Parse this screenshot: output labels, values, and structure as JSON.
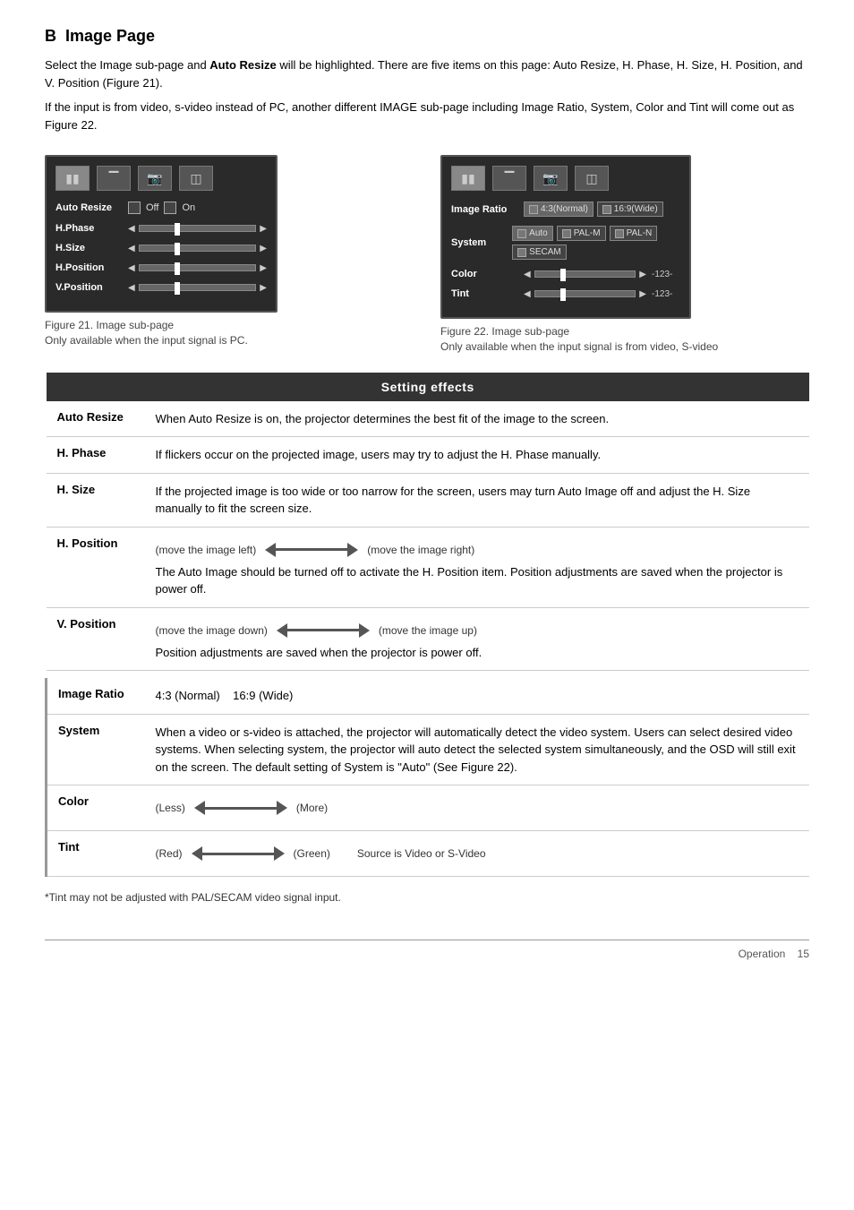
{
  "section": {
    "letter": "B",
    "title": "Image Page"
  },
  "intro": {
    "para1": "Select the Image sub-page and Auto Resize will be highlighted. There are five items on this page: Auto Resize, H. Phase, H. Size, H. Position, and V. Position (Figure 21).",
    "para2": "If the input is from video, s-video instead of PC, another different IMAGE sub-page including Image Ratio, System, Color and Tint will come out as Figure 22."
  },
  "figure21": {
    "caption_line1": "Figure 21. Image sub-page",
    "caption_line2": "Only available when the input signal is PC.",
    "rows": [
      {
        "label": "Auto Resize",
        "type": "checkbox",
        "opts": [
          "Off",
          "On"
        ]
      },
      {
        "label": "H.Phase",
        "type": "slider"
      },
      {
        "label": "H.Size",
        "type": "slider"
      },
      {
        "label": "H.Position",
        "type": "slider"
      },
      {
        "label": "V.Position",
        "type": "slider"
      }
    ]
  },
  "figure22": {
    "caption_line1": "Figure 22. Image sub-page",
    "caption_line2": "Only available when the input signal is from video, S-video",
    "rows": [
      {
        "label": "Image Ratio",
        "type": "options",
        "opts": [
          "4:3(Normal)",
          "16:9(Wide)"
        ]
      },
      {
        "label": "System",
        "type": "options",
        "opts": [
          "Auto",
          "PAL-M",
          "PAL-N",
          "SECAM"
        ]
      },
      {
        "label": "Color",
        "type": "slider_value",
        "value": "-123-"
      },
      {
        "label": "Tint",
        "type": "slider_value",
        "value": "-123-"
      }
    ]
  },
  "setting_effects": {
    "header": "Setting effects",
    "rows": [
      {
        "term": "Auto Resize",
        "desc": "When Auto Resize is on, the projector determines the best fit of the image to the screen."
      },
      {
        "term": "H. Phase",
        "desc": "If flickers occur on the projected image, users may try to adjust the H. Phase manually."
      },
      {
        "term": "H. Size",
        "desc": "If the projected image is too wide or too narrow for the screen, users may turn Auto Image off and adjust the H. Size manually to fit the screen size."
      },
      {
        "term": "H. Position",
        "left_label": "(move the image left)",
        "right_label": "(move the image right)",
        "desc2": "The Auto Image should be turned off to activate the H. Position item. Position adjustments are saved when the projector is power off."
      },
      {
        "term": "V. Position",
        "left_label": "(move the image down)",
        "right_label": "(move the image up)",
        "desc2": "Position adjustments are saved when the projector is power off."
      },
      {
        "term": "Image Ratio",
        "desc": "4:3 (Normal)    16:9 (Wide)",
        "is_ratio": true
      },
      {
        "term": "System",
        "desc": "When a video or s-video is attached, the projector will automatically detect the video system. Users can select desired video systems. When selecting system, the projector will auto detect the selected system simultaneously, and the OSD will still exit on the screen. The default setting of System is \"Auto\" (See Figure 22).",
        "is_ratio": true
      },
      {
        "term": "Color",
        "left_label": "(Less)",
        "right_label": "(More)",
        "is_ratio": true
      },
      {
        "term": "Tint",
        "left_label": "(Red)",
        "right_label": "(Green)",
        "extra_label": "Source is Video or S-Video",
        "is_ratio": true
      }
    ]
  },
  "footnote": "*Tint may not be adjusted with PAL/SECAM video signal input.",
  "footer": {
    "text": "Operation",
    "page": "15"
  }
}
